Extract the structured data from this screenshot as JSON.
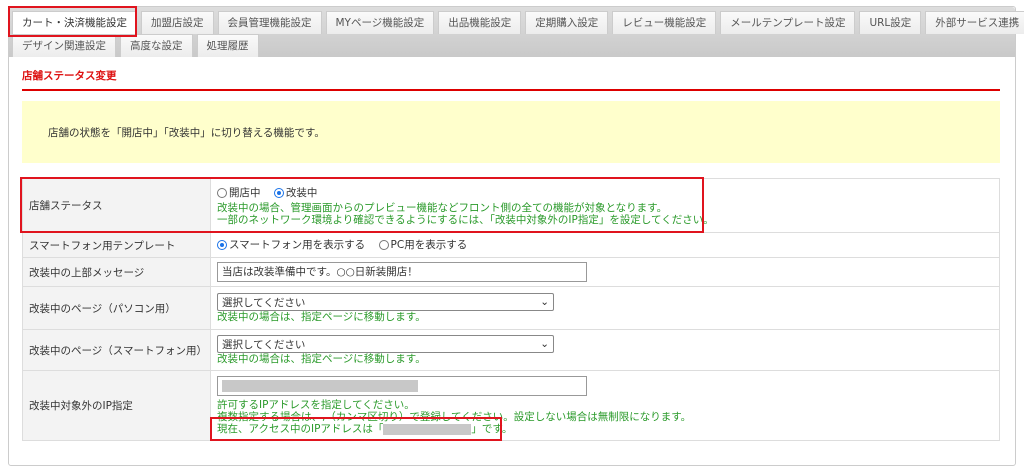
{
  "tabs_row1": [
    "カート・決済機能設定",
    "加盟店設定",
    "会員管理機能設定",
    "MYページ機能設定",
    "出品機能設定",
    "定期購入設定",
    "レビュー機能設定",
    "メールテンプレート設定",
    "URL設定",
    "外部サービス連携"
  ],
  "tabs_row2": [
    "デザイン関連設定",
    "高度な設定",
    "処理履歴"
  ],
  "section_title": "店舗ステータス変更",
  "notice": "店舗の状態を「開店中」「改装中」に切り替える機能です。",
  "rows": {
    "status": {
      "label": "店舗ステータス",
      "opt1": "開店中",
      "opt2": "改装中",
      "selected": "改装中",
      "help1": "改装中の場合、管理画面からのプレビュー機能などフロント側の全ての機能が対象となります。",
      "help2": "一部のネットワーク環境より確認できるようにするには、「改装中対象外のIP指定」を設定してください。"
    },
    "template": {
      "label": "スマートフォン用テンプレート",
      "opt1": "スマートフォン用を表示する",
      "opt2": "PC用を表示する",
      "selected": "スマートフォン用を表示する"
    },
    "message": {
      "label": "改装中の上部メッセージ",
      "value": "当店は改装準備中です。○○日新装開店！"
    },
    "page_pc": {
      "label": "改装中のページ（パソコン用）",
      "value": "選択してください",
      "help": "改装中の場合は、指定ページに移動します。"
    },
    "page_sp": {
      "label": "改装中のページ（スマートフォン用）",
      "value": "選択してください",
      "help": "改装中の場合は、指定ページに移動します。"
    },
    "ip": {
      "label": "改装中対象外のIP指定",
      "help1": "許可するIPアドレスを指定してください。",
      "help2": "複数指定する場合は、,（カンマ区切り）で登録してください。設定しない場合は無制限になります。",
      "current_prefix": "現在、アクセス中のIPアドレスは「",
      "current_suffix": "」です。"
    }
  }
}
